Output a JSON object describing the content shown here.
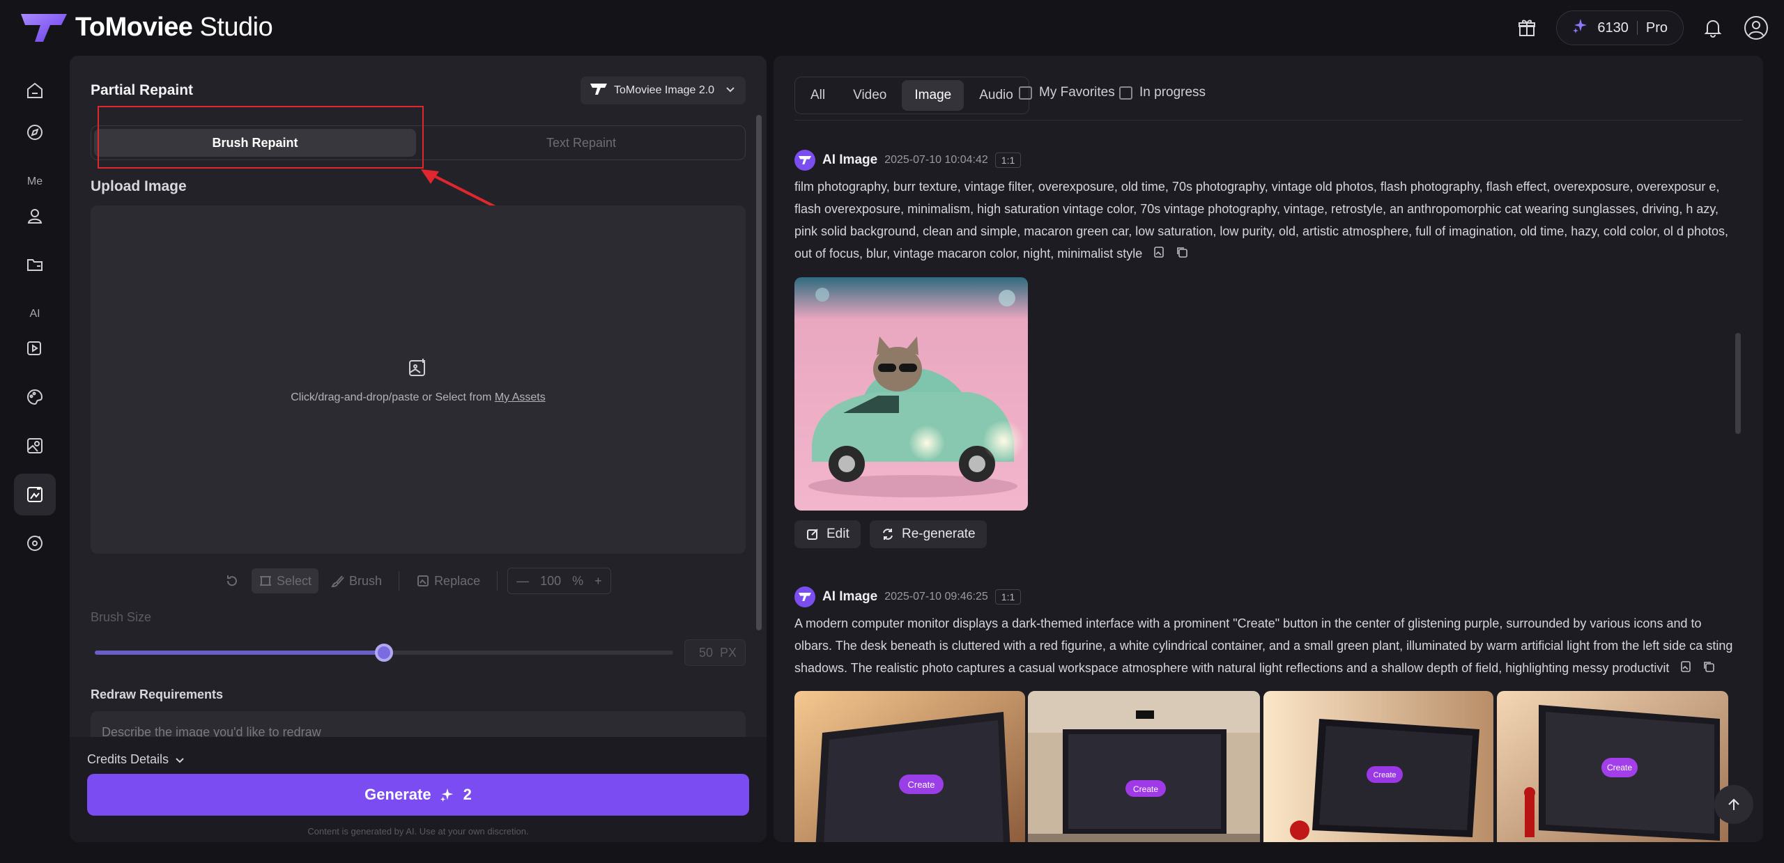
{
  "app": {
    "brand_bold": "ToMoviee",
    "brand_light": "Studio"
  },
  "header": {
    "credits": "6130",
    "plan": "Pro"
  },
  "nav": {
    "section_me": "Me",
    "section_ai": "AI"
  },
  "left_panel": {
    "title": "Partial Repaint",
    "model": "ToMoviee Image 2.0",
    "modes": [
      "Brush Repaint",
      "Text Repaint"
    ],
    "upload_label": "Upload Image",
    "upload_hint": "Click/drag-and-drop/paste or Select from",
    "upload_link": "My Assets",
    "tools": {
      "select": "Select",
      "brush": "Brush",
      "replace": "Replace",
      "zoom": "100",
      "zoom_unit": "%"
    },
    "brush_size_label": "Brush Size",
    "brush_size": "50",
    "brush_unit": "PX",
    "brush_level": 0.5,
    "redraw_label": "Redraw Requirements",
    "redraw_placeholder": "Describe the image you'd like to redraw",
    "credits_details": "Credits Details",
    "generate_label": "Generate",
    "generate_cost": "2",
    "disclaimer": "Content is generated by AI. Use at your own discretion."
  },
  "right_panel": {
    "tabs": [
      "All",
      "Video",
      "Image",
      "Audio"
    ],
    "active_tab": "Image",
    "favorites": "My Favorites",
    "in_progress": "In progress",
    "entries": [
      {
        "type": "AI Image",
        "time": "2025-07-10 10:04:42",
        "ratio": "1:1",
        "prompt": "film photography, burr texture, vintage filter, overexposure, old time, 70s photography, vintage old photos, flash photography, flash effect, overexposure, overexposur e, flash overexposure, minimalism, high saturation vintage color, 70s vintage photography, vintage, retrostyle, an anthropomorphic cat wearing sunglasses, driving, h azy, pink solid background, clean and simple, macaron green car, low saturation, low purity, old, artistic atmosphere, full of imagination, old time, hazy, cold color, ol d photos, out of focus, blur, vintage macaron color, night, minimalist style",
        "edit": "Edit",
        "regenerate": "Re-generate"
      },
      {
        "type": "AI Image",
        "time": "2025-07-10 09:46:25",
        "ratio": "1:1",
        "prompt": "A modern computer monitor displays a dark-themed interface with a prominent \"Create\" button in the center of glistening purple, surrounded by various icons and to olbars. The desk beneath is cluttered with a red figurine, a white cylindrical container, and a small green plant, illuminated by warm artificial light from the left side ca sting shadows. The realistic photo captures a casual workspace atmosphere with natural light reflections and a shallow depth of field, highlighting messy productivit",
        "button_text": "Create"
      }
    ]
  },
  "colors": {
    "accent": "#7a4cf2",
    "annotation": "#e0262f"
  }
}
